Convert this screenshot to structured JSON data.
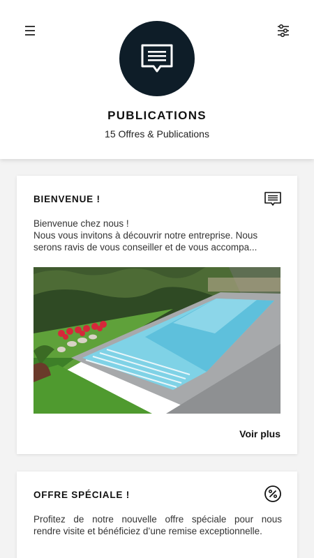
{
  "header": {
    "title": "PUBLICATIONS",
    "subtitle": "15 Offres & Publications",
    "avatar_color": "#0e1d28",
    "menu_icon": "hamburger-menu-icon",
    "filter_icon": "sliders-filter-icon",
    "avatar_icon": "message-bubble-icon"
  },
  "posts": [
    {
      "title": "BIENVENUE !",
      "icon": "message-bubble-icon",
      "text_lines": [
        "Bienvenue chez nous !",
        "Nous vous invitons à découvrir notre entreprise. Nous",
        "serons ravis de vous conseiller et de vous accompa..."
      ],
      "image_alt": "pool-photo",
      "more_label": "Voir plus"
    },
    {
      "title": "OFFRE SPÉCIALE !",
      "icon": "percent-badge-icon",
      "text_lines": [
        "Profitez de notre nouvelle offre spéciale pour nous",
        "rendre visite et bénéficiez d’une remise exceptionnelle."
      ]
    }
  ]
}
